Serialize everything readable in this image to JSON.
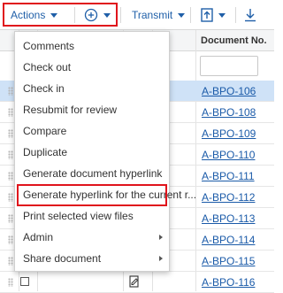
{
  "toolbar": {
    "actions_label": "Actions",
    "transmit_label": "Transmit",
    "add_icon": "plus-circle-icon",
    "upload_icon": "upload-icon",
    "download_icon": "download-icon"
  },
  "grid": {
    "columns": [
      "Document No."
    ],
    "rows": [
      {
        "doc_no": "A-BPO-106",
        "selected": true
      },
      {
        "doc_no": "A-BPO-108",
        "selected": false
      },
      {
        "doc_no": "A-BPO-109",
        "selected": false
      },
      {
        "doc_no": "A-BPO-110",
        "selected": false
      },
      {
        "doc_no": "A-BPO-111",
        "selected": false
      },
      {
        "doc_no": "A-BPO-112",
        "selected": false
      },
      {
        "doc_no": "A-BPO-113",
        "selected": false
      },
      {
        "doc_no": "A-BPO-114",
        "selected": false
      },
      {
        "doc_no": "A-BPO-115",
        "selected": false
      },
      {
        "doc_no": "A-BPO-116",
        "selected": false
      }
    ]
  },
  "menu": {
    "items": [
      {
        "label": "Comments",
        "submenu": false
      },
      {
        "label": "Check out",
        "submenu": false
      },
      {
        "label": "Check in",
        "submenu": false
      },
      {
        "label": "Resubmit for review",
        "submenu": false
      },
      {
        "label": "Compare",
        "submenu": false
      },
      {
        "label": "Duplicate",
        "submenu": false
      },
      {
        "label": "Generate document hyperlink",
        "submenu": false
      },
      {
        "label": "Generate hyperlink for the current r...",
        "submenu": false
      },
      {
        "label": "Print selected view files",
        "submenu": false
      },
      {
        "label": "Admin",
        "submenu": true
      },
      {
        "label": "Share document",
        "submenu": true
      }
    ]
  },
  "colors": {
    "accent": "#1f5fa8",
    "highlight": "#e0141c",
    "selected_row": "#cfe2f7"
  }
}
